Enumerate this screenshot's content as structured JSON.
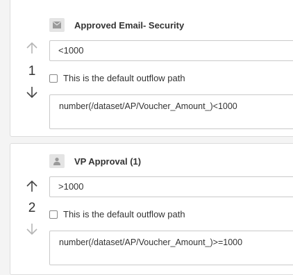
{
  "paths": [
    {
      "order": "1",
      "node_title": "Approved Email- Security",
      "node_icon": "envelope-icon",
      "condition": "<1000",
      "default_label": "This is the default outflow path",
      "default_checked": false,
      "expression": "number(/dataset/AP/Voucher_Amount_)<1000",
      "move_up_enabled": false,
      "move_down_enabled": true
    },
    {
      "order": "2",
      "node_title": "VP Approval (1)",
      "node_icon": "user-icon",
      "condition": ">1000",
      "default_label": "This is the default outflow path",
      "default_checked": false,
      "expression": "number(/dataset/AP/Voucher_Amount_)>=1000",
      "move_up_enabled": true,
      "move_down_enabled": false
    }
  ],
  "colors": {
    "arrow_enabled": "#444444",
    "arrow_disabled": "#b5b5b5",
    "border": "#c9c9c9"
  }
}
